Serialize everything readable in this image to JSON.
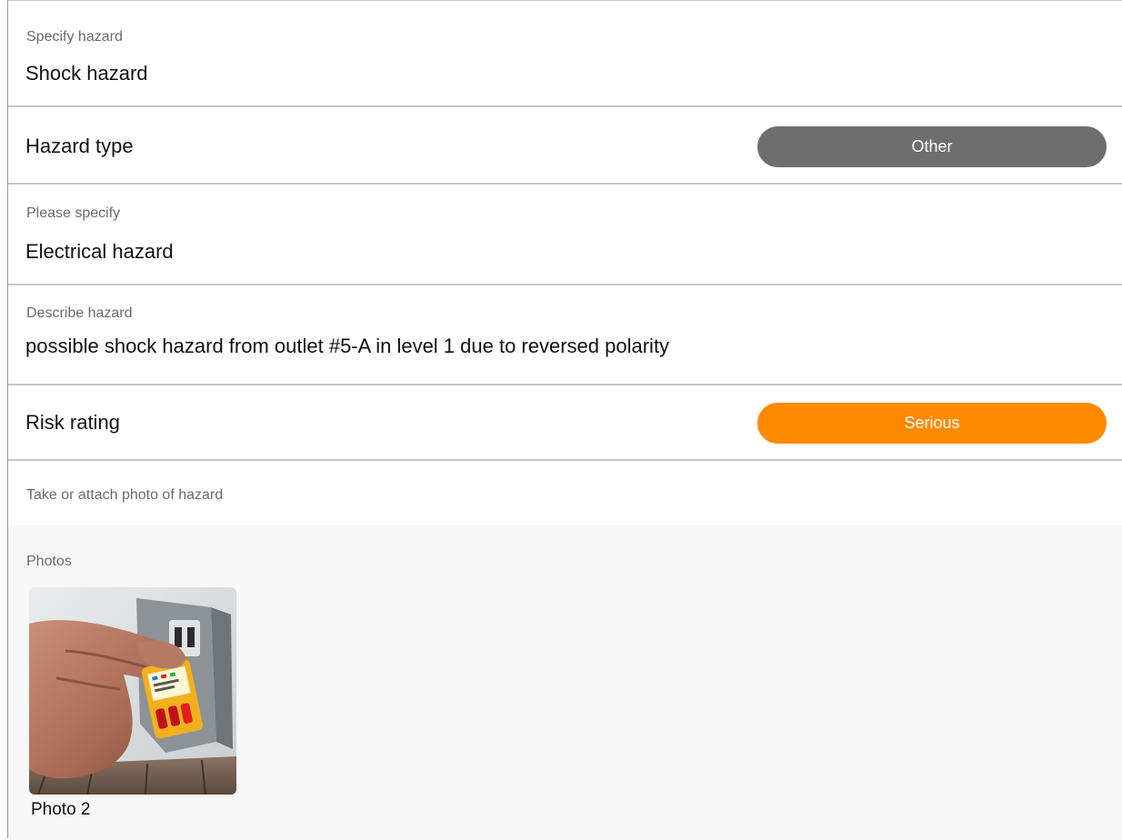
{
  "fields": {
    "specify_hazard": {
      "label": "Specify hazard",
      "value": "Shock hazard"
    },
    "hazard_type": {
      "label": "Hazard type",
      "value": "Other",
      "color": "#6e6e6e"
    },
    "please_specify": {
      "label": "Please specify",
      "value": "Electrical hazard"
    },
    "describe_hazard": {
      "label": "Describe hazard",
      "value": "possible shock hazard from outlet #5-A in level 1 due to reversed polarity"
    },
    "risk_rating": {
      "label": "Risk rating",
      "value": "Serious",
      "color": "#ff8a00"
    },
    "attach_photo": {
      "label": "Take or attach photo of hazard"
    }
  },
  "photos": {
    "label": "Photos",
    "items": [
      {
        "caption": "Photo 2"
      }
    ]
  }
}
